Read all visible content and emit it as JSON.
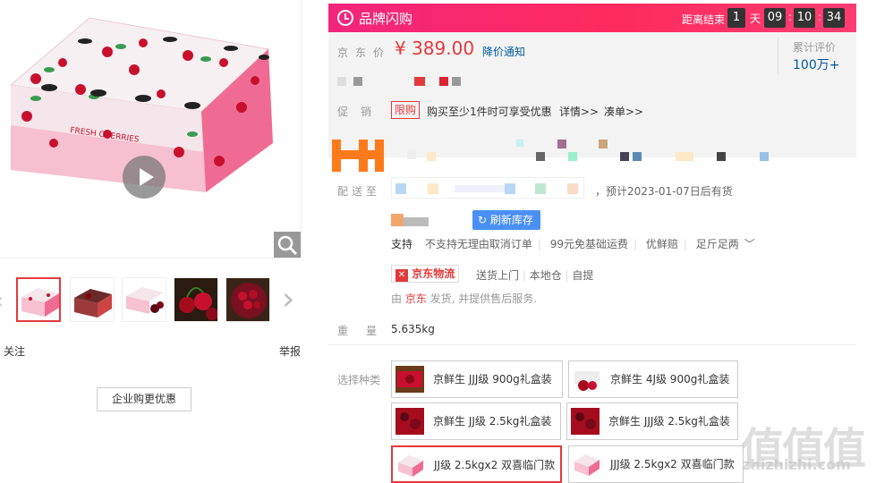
{
  "left": {
    "follow": "关注",
    "report": "举报",
    "business_button": "企业购更优惠",
    "main_image_labels": {
      "box_side": "FRESH CHERRIES"
    }
  },
  "flash": {
    "title": "品牌闪购",
    "countdown_label": "距离结束",
    "days": "1",
    "days_unit": "天",
    "hours": "09",
    "minutes": "10",
    "seconds": "34"
  },
  "price": {
    "label": "京东价",
    "value": "¥ 389.00",
    "notice": "降价通知",
    "review_label": "累计评价",
    "review_count": "100万+"
  },
  "promo": {
    "label": "促销",
    "tag": "限购",
    "text": "购买至少1件时可享受优惠",
    "detail": "详情>>",
    "bundle": "凑单>>"
  },
  "shipping": {
    "label": "配送至",
    "eta": "，预计2023-01-07日后有货",
    "refresh_button": "刷新库存"
  },
  "services": [
    "支持",
    "不支持无理由取消订单",
    "99元免基础运费",
    "优鲜赔",
    "足斤足两"
  ],
  "logistics": {
    "tag": "京东物流",
    "options": [
      "送货上门",
      "本地仓",
      "自提"
    ]
  },
  "seller": {
    "prefix": "由 ",
    "name": "京东",
    "suffix": " 发货, 并提供售后服务."
  },
  "weight": {
    "label": "重量",
    "value": "5.635kg"
  },
  "choose": {
    "label": "选择种类",
    "options": [
      "京鲜生 JJJ级 900g礼盒装",
      "京鲜生 4J级 900g礼盒装",
      "京鲜生 JJ级 2.5kg礼盒装",
      "京鲜生 JJJ级 2.5kg礼盒装",
      "JJ级 2.5kgx2 双喜临门款",
      "JJJ级 2.5kgx2 双喜临门款"
    ]
  },
  "watermark": {
    "text": "值值值",
    "url": "zhizhizhi.com"
  },
  "colors": {
    "accent": "#e4393c",
    "flash_start": "#f2267d",
    "flash_end": "#ff3d73",
    "link": "#005aa0",
    "refresh": "#4a90f4"
  }
}
